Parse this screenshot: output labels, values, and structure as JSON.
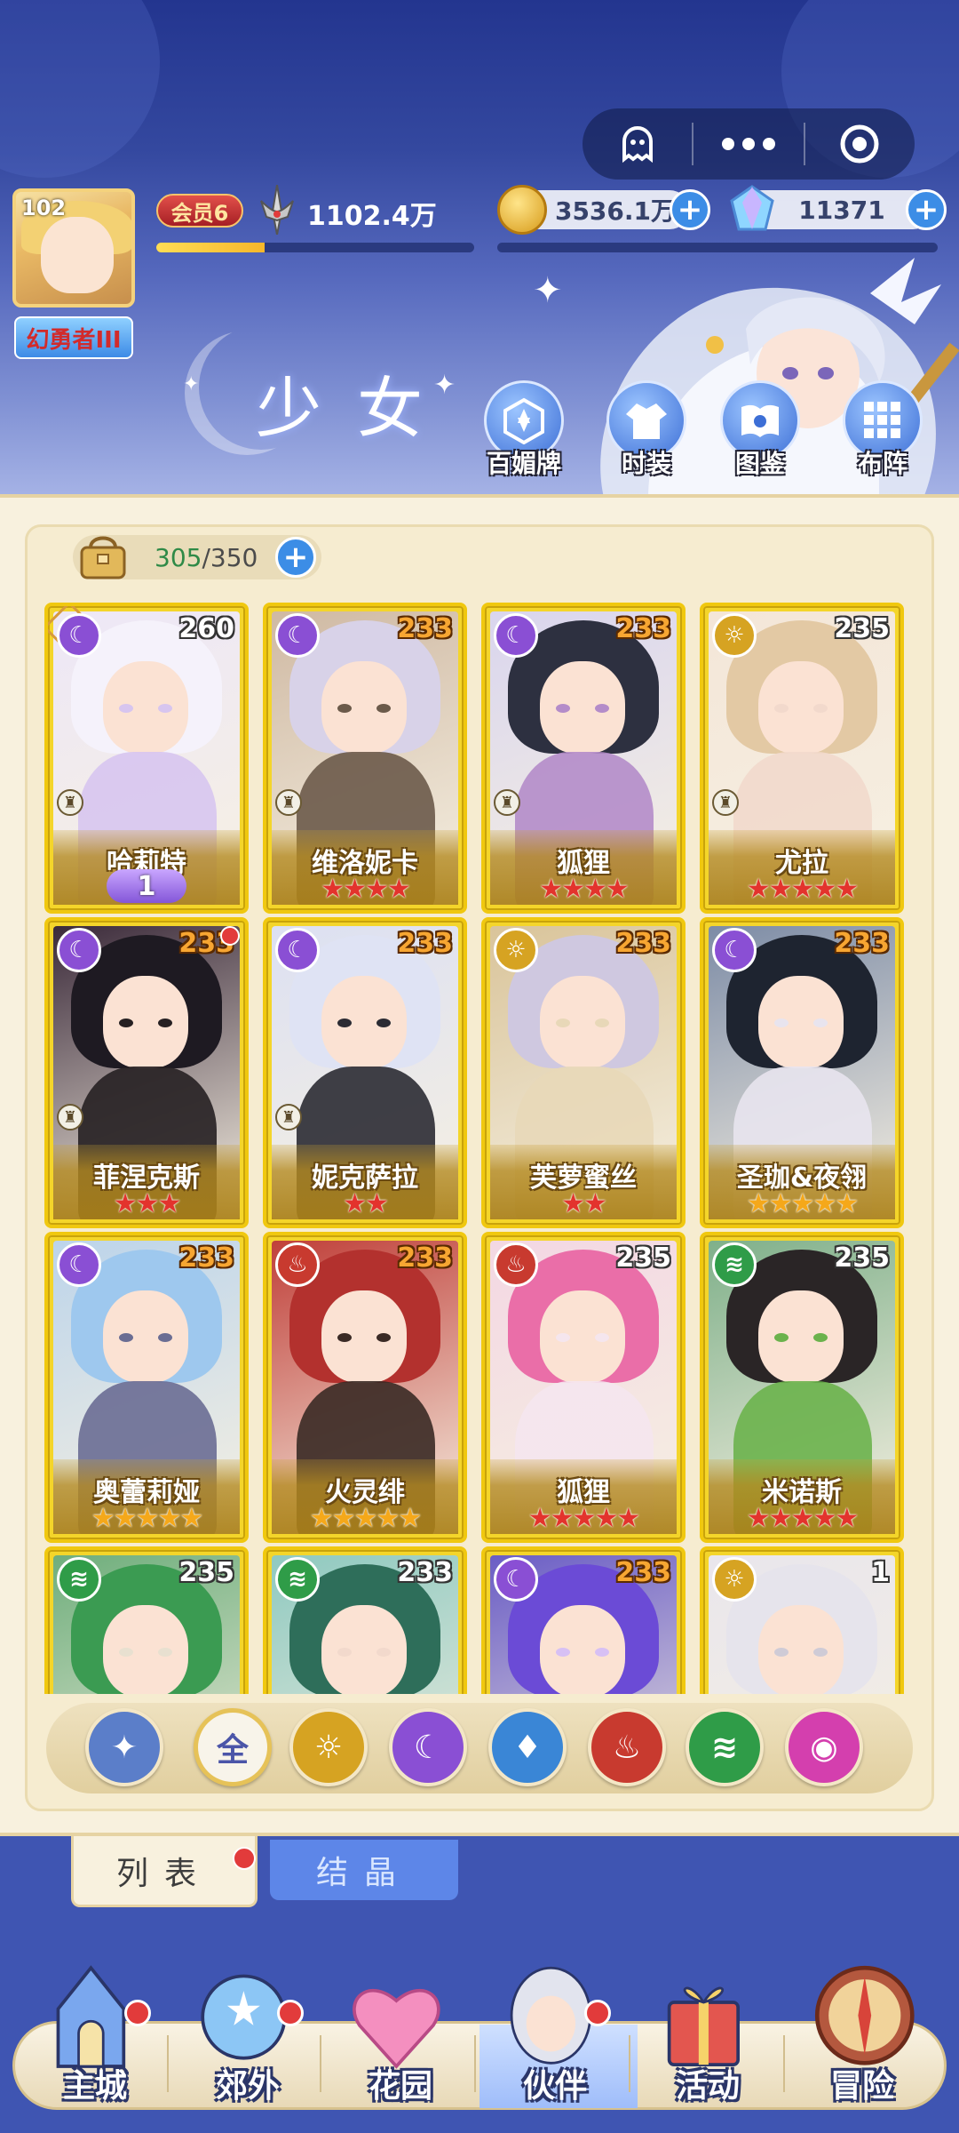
{
  "header": {
    "player_level": "102",
    "player_title": "幻勇者III",
    "vip_label": "会员6",
    "power": "1102.4万",
    "xp_fraction": 0.34,
    "gold": "3536.1万",
    "gems": "11371",
    "section_title": "少女",
    "buttons": [
      {
        "label": "百媚牌",
        "icon": "card-deck-icon"
      },
      {
        "label": "时装",
        "icon": "outfit-icon"
      },
      {
        "label": "图鉴",
        "icon": "book-icon"
      },
      {
        "label": "布阵",
        "icon": "formation-grid-icon"
      }
    ]
  },
  "roster": {
    "current": "305",
    "max": "/350"
  },
  "cards": [
    {
      "name": "哈莉特",
      "level": "260",
      "element": "moon",
      "stars": 0,
      "badge": "1",
      "rook": true,
      "diamond": true,
      "level_orange": false
    },
    {
      "name": "维洛妮卡",
      "level": "233",
      "element": "moon",
      "stars": 4,
      "rook": true,
      "level_orange": true
    },
    {
      "name": "狐狸",
      "level": "233",
      "element": "moon",
      "stars": 4,
      "rook": true,
      "level_orange": true
    },
    {
      "name": "尤拉",
      "level": "235",
      "element": "light",
      "stars": 5,
      "rook": true,
      "level_orange": false
    },
    {
      "name": "菲涅克斯",
      "level": "233",
      "element": "moon",
      "stars": 3,
      "rook": true,
      "dot": true,
      "level_orange": true
    },
    {
      "name": "妮克萨拉",
      "level": "233",
      "element": "moon",
      "stars": 2,
      "rook": true,
      "level_orange": true
    },
    {
      "name": "芙萝蜜丝",
      "level": "233",
      "element": "light",
      "stars": 2,
      "level_orange": true
    },
    {
      "name": "圣珈&夜翎",
      "level": "233",
      "element": "moon",
      "stars": 5,
      "gold": true,
      "level_orange": true
    },
    {
      "name": "奥蕾莉娅",
      "level": "233",
      "element": "moon",
      "stars": 5,
      "gold": true,
      "level_orange": true
    },
    {
      "name": "火灵绯",
      "level": "233",
      "element": "fire",
      "stars": 5,
      "gold": true,
      "level_orange": true
    },
    {
      "name": "狐狸",
      "level": "235",
      "element": "fire",
      "stars": 5,
      "level_orange": false
    },
    {
      "name": "米诺斯",
      "level": "235",
      "element": "wind",
      "stars": 5,
      "level_orange": false
    },
    {
      "name": "",
      "level": "235",
      "element": "wind",
      "stars": 0,
      "level_orange": false
    },
    {
      "name": "",
      "level": "233",
      "element": "wind",
      "stars": 0,
      "level_orange": false
    },
    {
      "name": "",
      "level": "233",
      "element": "moon",
      "stars": 0,
      "level_orange": true
    },
    {
      "name": "",
      "level": "1",
      "element": "light",
      "stars": 0,
      "level_orange": false
    }
  ],
  "filters": [
    {
      "id": "formation",
      "label": "",
      "color": "#5b7ec9"
    },
    {
      "id": "all",
      "label": "全",
      "color": "#f8f4ea",
      "active": true
    },
    {
      "id": "light",
      "label": "",
      "color": "#d6a322"
    },
    {
      "id": "moon",
      "label": "",
      "color": "#8a4fd4"
    },
    {
      "id": "water",
      "label": "",
      "color": "#3a86d6"
    },
    {
      "id": "fire",
      "label": "",
      "color": "#c83a2f"
    },
    {
      "id": "wind",
      "label": "",
      "color": "#2f9c48"
    },
    {
      "id": "chaos",
      "label": "",
      "color": "#d43fae"
    }
  ],
  "tabs": {
    "list": "列表",
    "crystal": "结晶"
  },
  "nav": [
    {
      "label": "主城",
      "icon": "castle-icon",
      "dot": true
    },
    {
      "label": "郊外",
      "icon": "portal-icon",
      "dot": true
    },
    {
      "label": "花园",
      "icon": "heart-icon",
      "dot": false
    },
    {
      "label": "伙伴",
      "icon": "companion-icon",
      "dot": true,
      "active": true
    },
    {
      "label": "活动",
      "icon": "gift-icon",
      "dot": false
    },
    {
      "label": "冒险",
      "icon": "compass-icon",
      "dot": false
    }
  ],
  "colors": {
    "moon": "#8a4fd4",
    "light": "#d6a322",
    "fire": "#c83a2f",
    "wind": "#2f9c48",
    "card_gold": "#f4d52a"
  }
}
